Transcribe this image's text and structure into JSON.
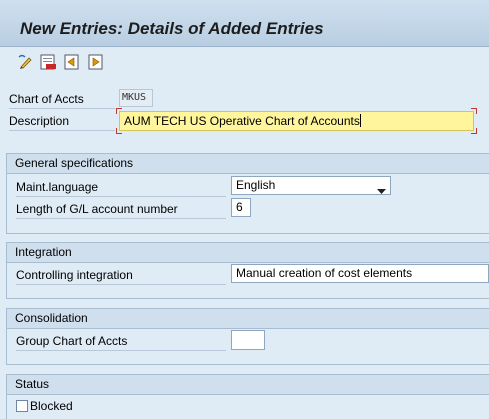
{
  "screen": {
    "title": "New Entries: Details of Added Entries"
  },
  "toolbar": {
    "buttons": [
      {
        "name": "edit-icon"
      },
      {
        "name": "delete-icon"
      },
      {
        "name": "previous-entry-icon"
      },
      {
        "name": "next-entry-icon"
      }
    ]
  },
  "header": {
    "chart_label": "Chart of Accts",
    "chart_value": "MKUS",
    "description_label": "Description",
    "description_value": "AUM TECH US Operative Chart of Accounts"
  },
  "general": {
    "title": "General specifications",
    "maint_language_label": "Maint.language",
    "maint_language_value": "English",
    "gl_length_label": "Length of G/L account number",
    "gl_length_value": "6"
  },
  "integration": {
    "title": "Integration",
    "controlling_label": "Controlling integration",
    "controlling_value": "Manual creation of cost elements"
  },
  "consolidation": {
    "title": "Consolidation",
    "group_chart_label": "Group Chart of Accts",
    "group_chart_value": ""
  },
  "status": {
    "title": "Status",
    "blocked_label": "Blocked",
    "blocked_checked": false
  },
  "colors": {
    "background": "#dfebf5",
    "group_header": "#cfdfee",
    "highlight_field": "#fff59d",
    "required_marker": "#c0392b"
  }
}
